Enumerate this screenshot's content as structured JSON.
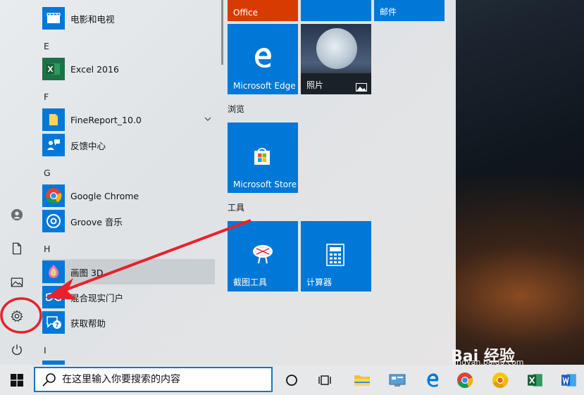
{
  "app_list": {
    "items": [
      {
        "label": "电影和电视"
      },
      {
        "letter": "E"
      },
      {
        "label": "Excel 2016"
      },
      {
        "letter": "F"
      },
      {
        "label": "FineReport_10.0"
      },
      {
        "label": "反馈中心"
      },
      {
        "letter": "G"
      },
      {
        "label": "Google Chrome"
      },
      {
        "label": "Groove 音乐"
      },
      {
        "letter": "H"
      },
      {
        "label": "画图 3D"
      },
      {
        "label": "混合现实门户"
      },
      {
        "label": "获取帮助"
      },
      {
        "letter": "I"
      }
    ]
  },
  "tiles": {
    "office_label": "Office",
    "mail_label": "邮件",
    "edge_label": "Microsoft Edge",
    "photos_label": "照片",
    "browse_group": "浏览",
    "store_label": "Microsoft Store",
    "tools_group": "工具",
    "snip_label": "截图工具",
    "calc_label": "计算器"
  },
  "search": {
    "placeholder": "在这里输入你要搜索的内容"
  },
  "watermark": {
    "brand": "Bai 经验",
    "url": "jingyan.baidu.com"
  },
  "colors": {
    "tile_blue": "#0078d7",
    "office_orange": "#d83b01",
    "annotation_red": "#e8212a"
  }
}
